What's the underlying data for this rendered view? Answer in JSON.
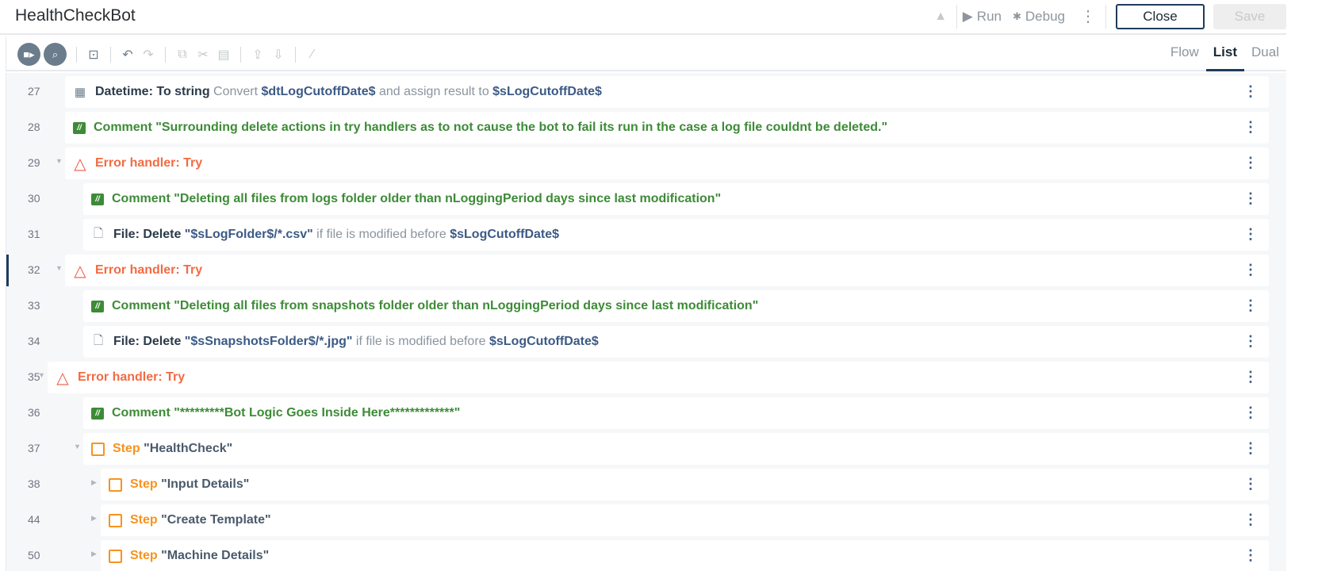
{
  "header": {
    "title": "HealthCheckBot",
    "run_label": "Run",
    "debug_label": "Debug",
    "close_label": "Close",
    "save_label": "Save"
  },
  "view_tabs": [
    {
      "label": "Flow",
      "active": false
    },
    {
      "label": "List",
      "active": true
    },
    {
      "label": "Dual",
      "active": false
    }
  ],
  "selected_line": "32",
  "rows": [
    {
      "line": "27",
      "depth": 1,
      "icon": "calendar",
      "parts": [
        [
          "title",
          "Datetime: To string"
        ],
        [
          "muted",
          " Convert "
        ],
        [
          "var",
          "$dtLogCutoffDate$"
        ],
        [
          "muted",
          " and assign result to "
        ],
        [
          "var",
          "$sLogCutoffDate$"
        ]
      ]
    },
    {
      "line": "28",
      "depth": 1,
      "icon": "comment",
      "parts": [
        [
          "comment",
          "Comment \"Surrounding delete actions in try handlers as to not cause the bot to fail its run in the case a log file couldnt be deleted.\""
        ]
      ]
    },
    {
      "line": "29",
      "depth": 1,
      "icon": "error",
      "caret": "down",
      "parts": [
        [
          "error",
          "Error handler: Try"
        ]
      ]
    },
    {
      "line": "30",
      "depth": 2,
      "icon": "comment",
      "parts": [
        [
          "comment",
          "Comment \"Deleting all files from logs folder older than nLoggingPeriod days since last modification\""
        ]
      ]
    },
    {
      "line": "31",
      "depth": 2,
      "icon": "file",
      "parts": [
        [
          "title",
          "File: Delete"
        ],
        [
          "var",
          " \"$sLogFolder$/*.csv\""
        ],
        [
          "muted",
          " if file is modified before "
        ],
        [
          "var",
          "$sLogCutoffDate$"
        ]
      ]
    },
    {
      "line": "32",
      "depth": 1,
      "icon": "error",
      "caret": "down",
      "parts": [
        [
          "error",
          "Error handler: Try"
        ]
      ]
    },
    {
      "line": "33",
      "depth": 2,
      "icon": "comment",
      "parts": [
        [
          "comment",
          "Comment \"Deleting all files from snapshots folder older than nLoggingPeriod days since last modification\""
        ]
      ]
    },
    {
      "line": "34",
      "depth": 2,
      "icon": "file",
      "parts": [
        [
          "title",
          "File: Delete"
        ],
        [
          "var",
          " \"$sSnapshotsFolder$/*.jpg\""
        ],
        [
          "muted",
          " if file is modified before "
        ],
        [
          "var",
          "$sLogCutoffDate$"
        ]
      ]
    },
    {
      "line": "35",
      "depth": 0,
      "icon": "error",
      "caret": "down",
      "parts": [
        [
          "error",
          "Error handler: Try"
        ]
      ]
    },
    {
      "line": "36",
      "depth": 2,
      "icon": "comment",
      "parts": [
        [
          "comment",
          "Comment \"*********Bot Logic Goes Inside Here*************\""
        ]
      ]
    },
    {
      "line": "37",
      "depth": 2,
      "icon": "step",
      "caret": "down",
      "parts": [
        [
          "step",
          "Step"
        ],
        [
          "name",
          " \"HealthCheck\""
        ]
      ]
    },
    {
      "line": "38",
      "depth": 3,
      "icon": "step",
      "caret": "right",
      "parts": [
        [
          "step",
          "Step"
        ],
        [
          "name",
          " \"Input Details\""
        ]
      ]
    },
    {
      "line": "44",
      "depth": 3,
      "icon": "step",
      "caret": "right",
      "parts": [
        [
          "step",
          "Step"
        ],
        [
          "name",
          " \"Create Template\""
        ]
      ]
    },
    {
      "line": "50",
      "depth": 3,
      "icon": "step",
      "caret": "right",
      "parts": [
        [
          "step",
          "Step"
        ],
        [
          "name",
          " \"Machine Details\""
        ]
      ]
    }
  ]
}
